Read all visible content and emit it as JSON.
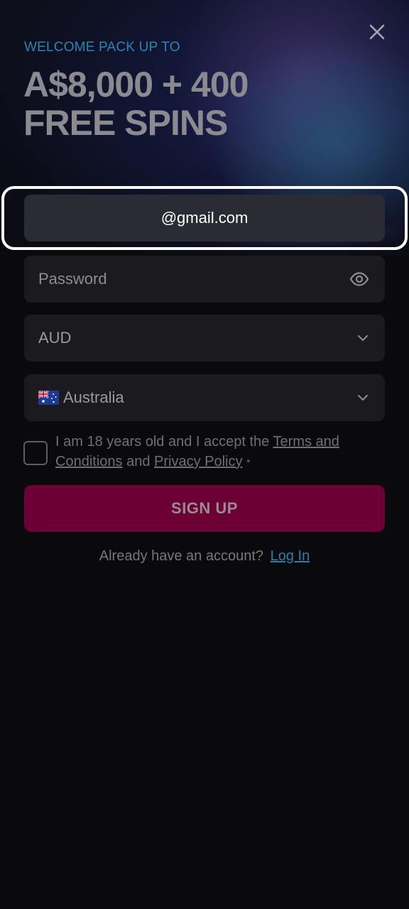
{
  "hero": {
    "welcome": "WELCOME PACK UP TO",
    "headline_line1": "A$8,000 + 400",
    "headline_line2": "FREE SPINS"
  },
  "form": {
    "email_value": "@gmail.com",
    "password_placeholder": "Password",
    "currency_value": "AUD",
    "country_value": "Australia",
    "terms_prefix": "I am 18 years old and I accept the",
    "terms_link": "Terms and Conditions",
    "terms_and": "and",
    "privacy_link": "Privacy Policy",
    "required_mark": "*",
    "signup_label": "SIGN UP",
    "login_prompt": "Already have an account?",
    "login_link": "Log In"
  },
  "icons": {
    "close": "close-icon",
    "eye": "eye-icon",
    "chevron": "chevron-down-icon",
    "flag": "australia-flag-icon"
  },
  "colors": {
    "accent_blue": "#2a86b0",
    "signup_bg": "#6b0035",
    "field_bg": "#1a1a1f",
    "page_bg": "#0a0a0c"
  }
}
